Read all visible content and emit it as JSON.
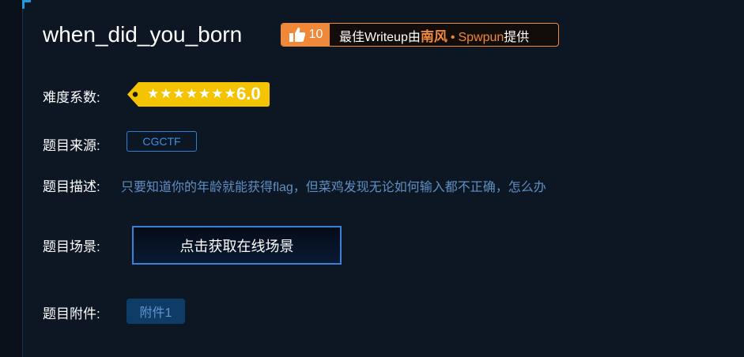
{
  "challenge": {
    "title": "when_did_you_born"
  },
  "writeup": {
    "like_count": "10",
    "prefix": "最佳Writeup由",
    "author": "南风",
    "separator": "•",
    "team": "Spwpun",
    "suffix": "提供"
  },
  "difficulty": {
    "label": "难度系数:",
    "stars": "★★★★★★★",
    "score": "6.0",
    "colors": {
      "tag": "#f5c400",
      "text": "#ffffff"
    }
  },
  "source": {
    "label": "题目来源:",
    "value": "CGCTF"
  },
  "description": {
    "label": "题目描述:",
    "text": "只要知道你的年龄就能获得flag，但菜鸡发现无论如何输入都不正确，怎么办"
  },
  "scene": {
    "label": "题目场景:",
    "button": "点击获取在线场景"
  },
  "attachment": {
    "label": "题目附件:",
    "button": "附件1"
  },
  "icons": [
    "thumbs-up-icon",
    "star-icon"
  ],
  "colors": {
    "accent_orange": "#f0883a",
    "link_blue": "#3d8ee0",
    "background": "#0d1724"
  }
}
